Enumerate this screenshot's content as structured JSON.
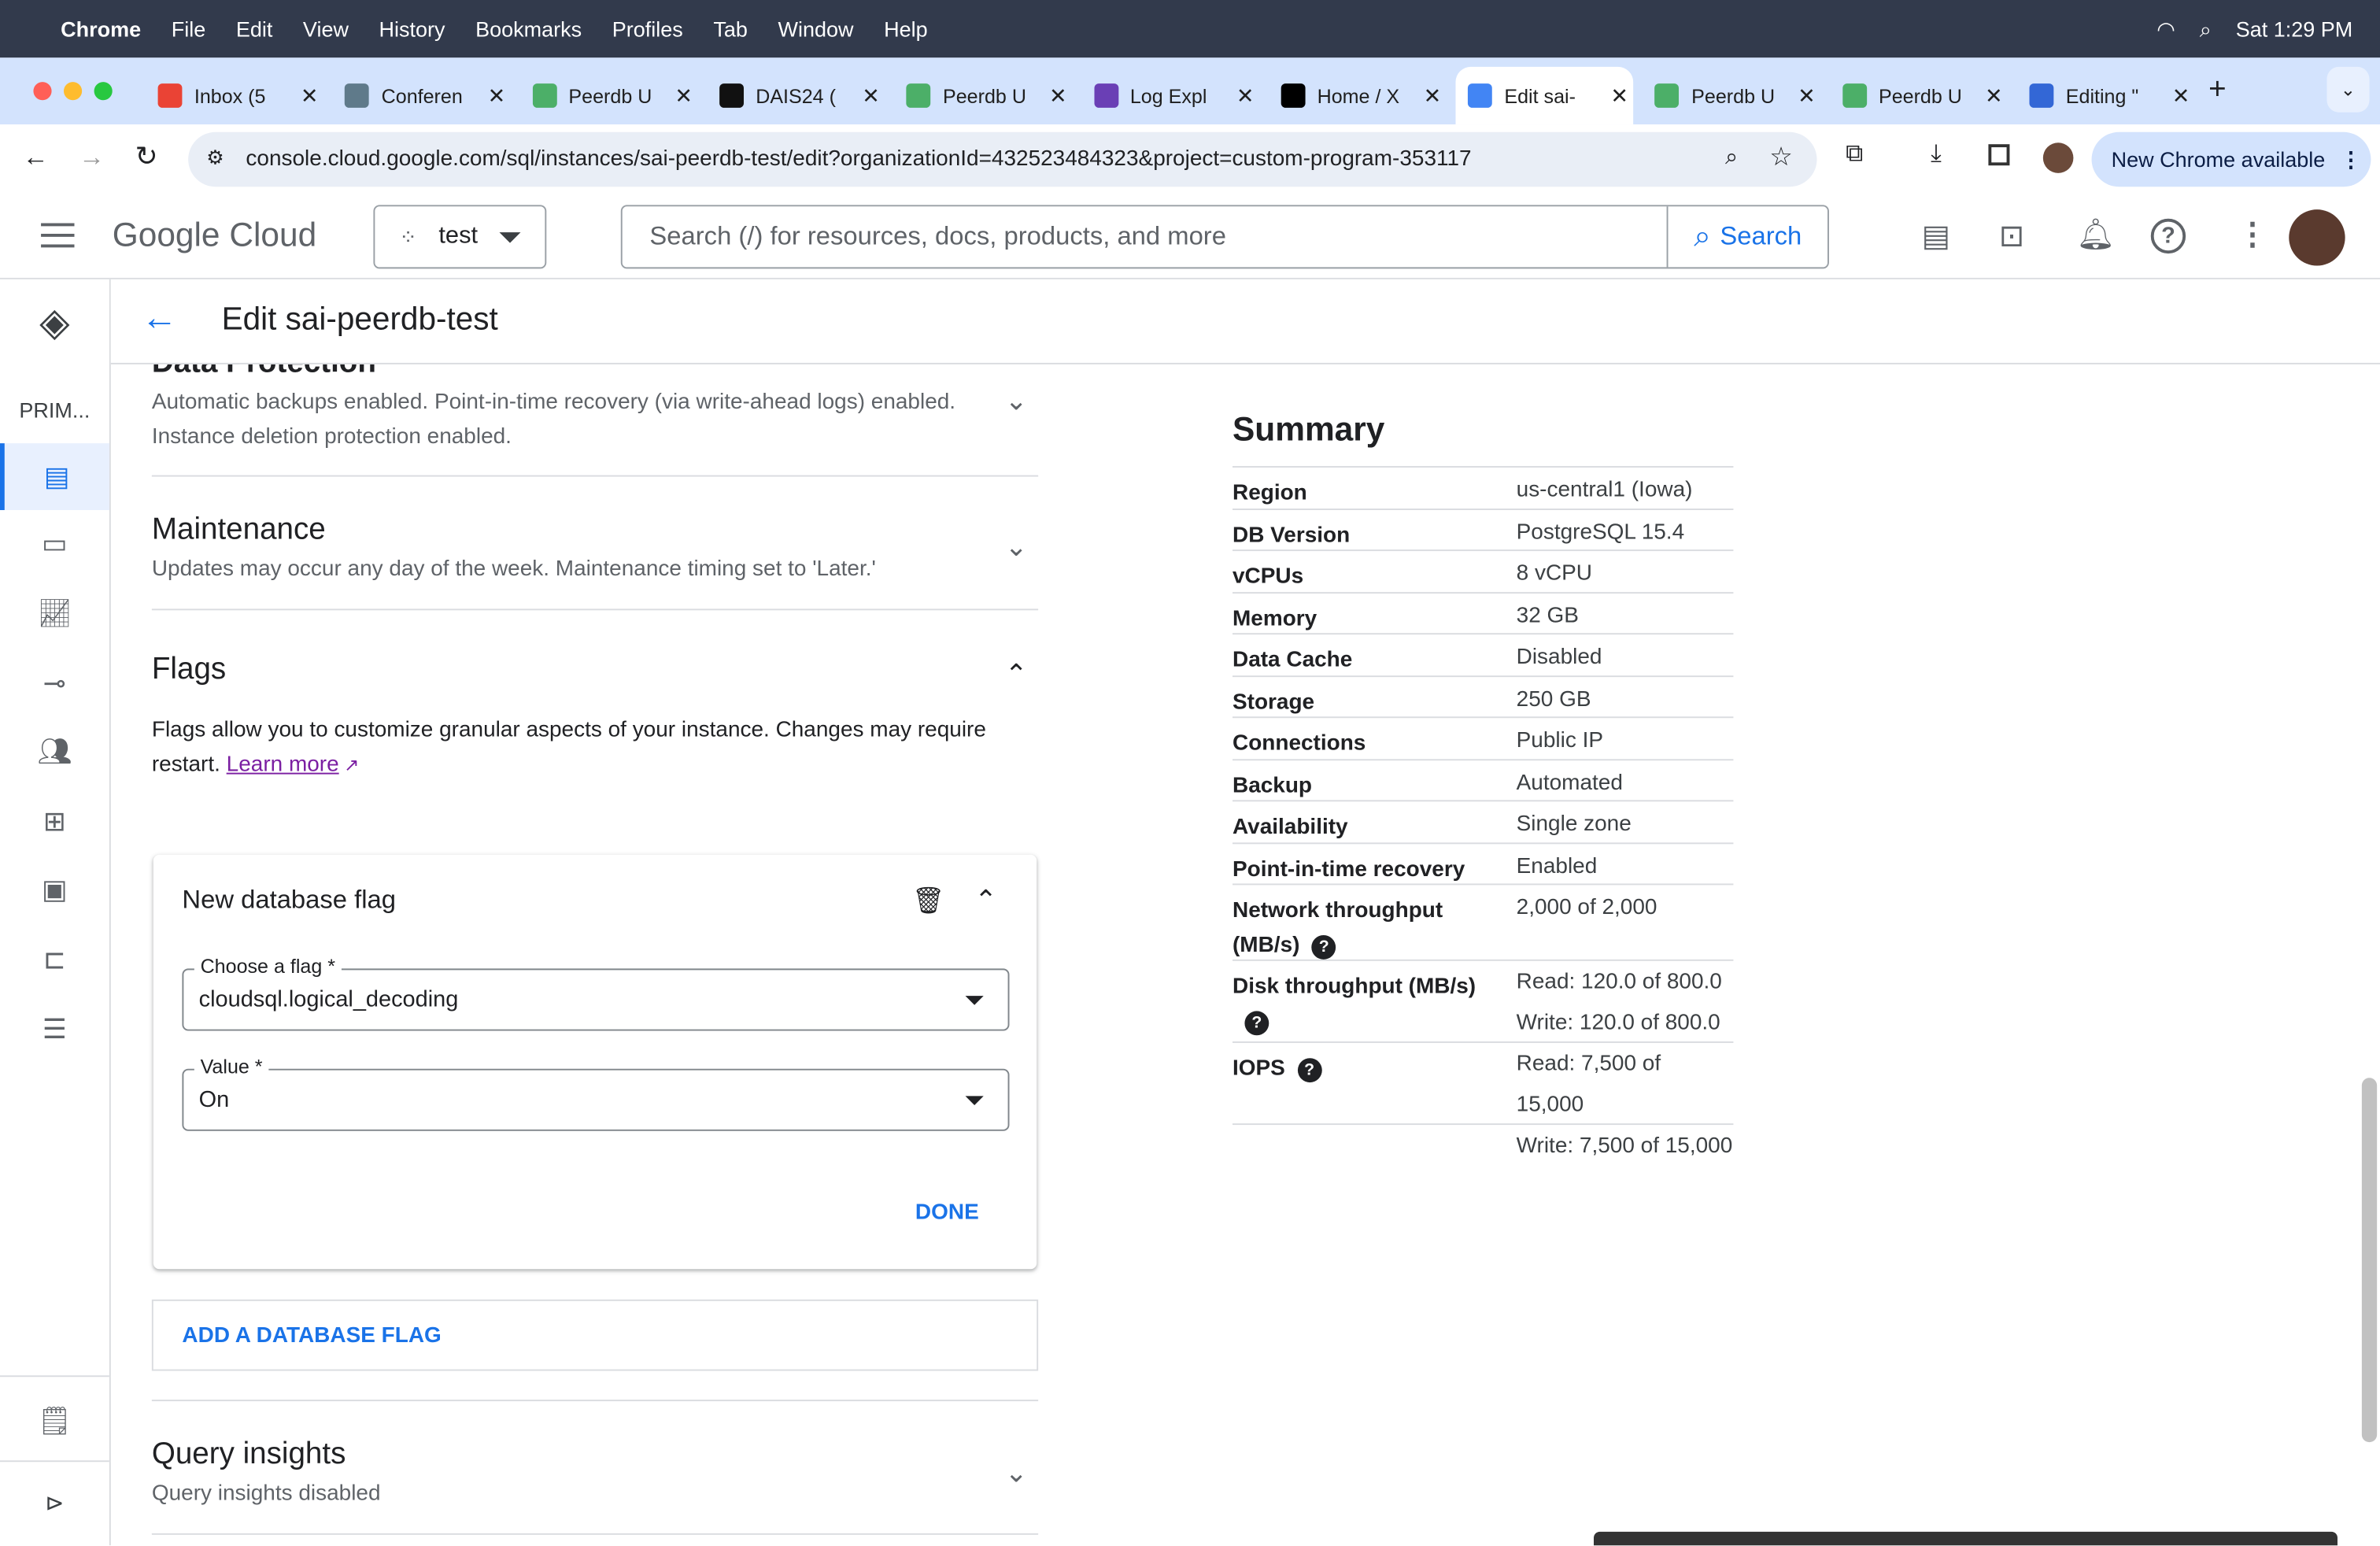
{
  "menubar": {
    "app": "Chrome",
    "items": [
      "File",
      "Edit",
      "View",
      "History",
      "Bookmarks",
      "Profiles",
      "Tab",
      "Window",
      "Help"
    ],
    "clock": "Sat 1:29 PM"
  },
  "tabs": [
    {
      "title": "Inbox (5",
      "color": "#ea4335"
    },
    {
      "title": "Conferen",
      "color": "#5f7a8a"
    },
    {
      "title": "Peerdb U",
      "color": "#4caf68"
    },
    {
      "title": "DAIS24 (",
      "color": "#111111"
    },
    {
      "title": "Peerdb U",
      "color": "#4caf68"
    },
    {
      "title": "Log Expl",
      "color": "#6a3fb5"
    },
    {
      "title": "Home / X",
      "color": "#000000"
    },
    {
      "title": "Edit sai-",
      "color": "#4285f4",
      "active": true
    },
    {
      "title": "Peerdb U",
      "color": "#4caf68"
    },
    {
      "title": "Peerdb U",
      "color": "#4caf68"
    },
    {
      "title": "Editing \"",
      "color": "#3367d6"
    }
  ],
  "address": {
    "url": "console.cloud.google.com/sql/instances/sai-peerdb-test/edit?organizationId=432523484323&project=custom-program-353117",
    "new_chrome": "New Chrome available"
  },
  "header": {
    "logo": "Google Cloud",
    "project": "test",
    "search_placeholder": "Search (/) for resources, docs, products, and more",
    "search_button": "Search"
  },
  "rail": {
    "label": "PRIM..."
  },
  "page": {
    "title": "Edit sai-peerdb-test"
  },
  "sections": {
    "data_protection": {
      "title": "Data Protection",
      "subtitle": "Automatic backups enabled. Point-in-time recovery (via write-ahead logs) enabled. Instance deletion protection enabled."
    },
    "maintenance": {
      "title": "Maintenance",
      "subtitle": "Updates may occur any day of the week. Maintenance timing set to 'Later.'"
    },
    "flags": {
      "title": "Flags",
      "description": "Flags allow you to customize granular aspects of your instance. Changes may require restart.",
      "learn_more": "Learn more",
      "card": {
        "title": "New database flag",
        "flag_label": "Choose a flag *",
        "flag_value": "cloudsql.logical_decoding",
        "value_label": "Value *",
        "value_value": "On",
        "done": "DONE"
      },
      "add": "ADD A DATABASE FLAG"
    },
    "query_insights": {
      "title": "Query insights",
      "subtitle": "Query insights disabled"
    }
  },
  "summary": {
    "title": "Summary",
    "rows": [
      {
        "k": "Region",
        "v": [
          "us-central1 (Iowa)"
        ]
      },
      {
        "k": "DB Version",
        "v": [
          "PostgreSQL 15.4"
        ]
      },
      {
        "k": "vCPUs",
        "v": [
          "8 vCPU"
        ]
      },
      {
        "k": "Memory",
        "v": [
          "32 GB"
        ]
      },
      {
        "k": "Data Cache",
        "v": [
          "Disabled"
        ]
      },
      {
        "k": "Storage",
        "v": [
          "250 GB"
        ]
      },
      {
        "k": "Connections",
        "v": [
          "Public IP"
        ]
      },
      {
        "k": "Backup",
        "v": [
          "Automated"
        ]
      },
      {
        "k": "Availability",
        "v": [
          "Single zone"
        ]
      },
      {
        "k": "Point-in-time recovery",
        "v": [
          "Enabled"
        ]
      },
      {
        "k": "Network throughput (MB/s)",
        "v": [
          "2,000 of 2,000"
        ],
        "help": true
      },
      {
        "k": "Disk throughput (MB/s)",
        "v": [
          "Read: 120.0 of 800.0",
          "Write: 120.0 of 800.0"
        ],
        "help": true
      },
      {
        "k": "IOPS",
        "v": [
          "Read: 7,500 of 15,000",
          "Write: 7,500 of 15,000"
        ],
        "help": true
      }
    ]
  }
}
